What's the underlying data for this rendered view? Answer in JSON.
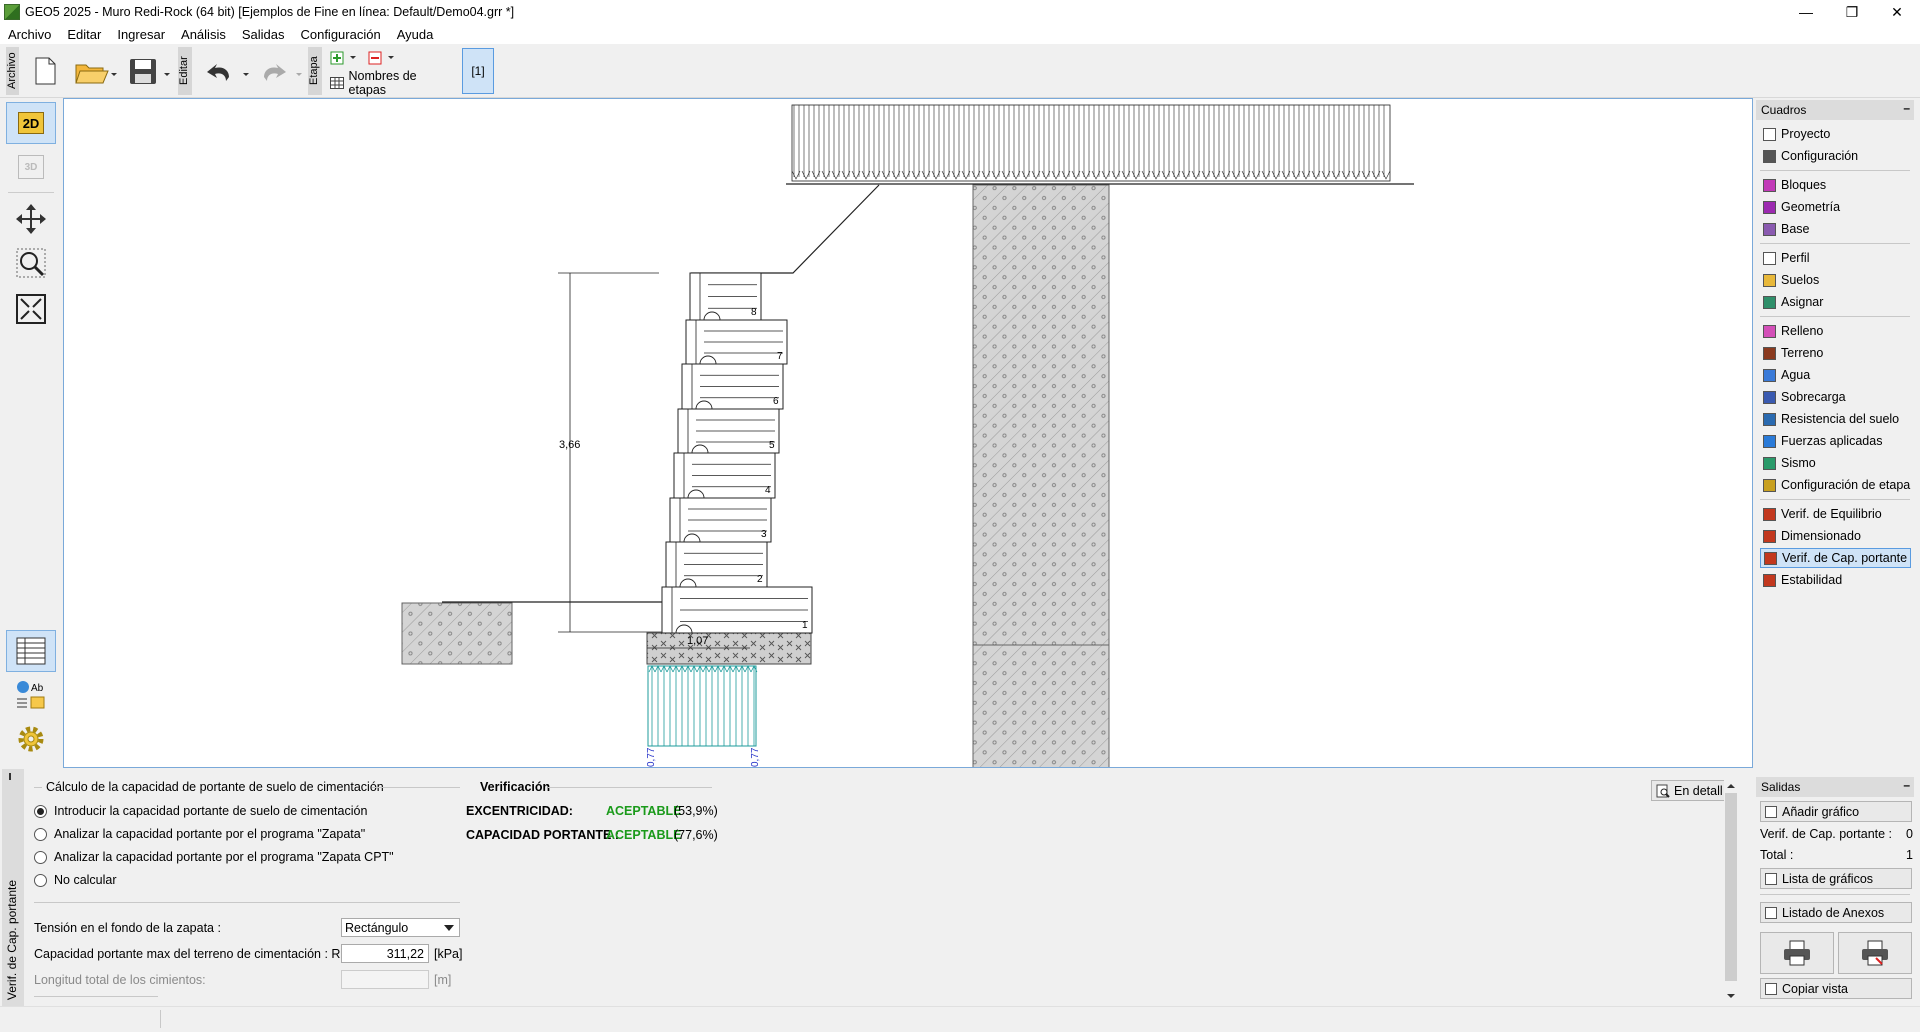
{
  "window": {
    "title": "GEO5 2025 - Muro Redi-Rock  (64 bit) [Ejemplos de Fine en línea: Default/Demo04.grr *]",
    "minimize": "—",
    "restore": "❐",
    "close": "✕"
  },
  "menu": [
    "Archivo",
    "Editar",
    "Ingresar",
    "Análisis",
    "Salidas",
    "Configuración",
    "Ayuda"
  ],
  "toolbar": {
    "archivo_label": "Archivo",
    "editar_label": "Editar",
    "etapa_label": "Etapa",
    "stage_names_label": "Nombres de etapas",
    "stage_current": "[1]"
  },
  "left_tools": {
    "view_2d": "2D",
    "view_3d": "3D"
  },
  "drawing": {
    "height_dim": "3,66",
    "base_dim": "1,07",
    "block_numbers": [
      "1",
      "2",
      "3",
      "4",
      "5",
      "6",
      "7",
      "8"
    ],
    "stress_left": "0,77",
    "stress_right": "0,77"
  },
  "right_panel": {
    "header": "Cuadros",
    "groups": [
      [
        {
          "label": "Proyecto",
          "icon": "project-icon"
        },
        {
          "label": "Configuración",
          "icon": "gear-icon"
        }
      ],
      [
        {
          "label": "Bloques",
          "icon": "blocks-icon"
        },
        {
          "label": "Geometría",
          "icon": "geometry-icon"
        },
        {
          "label": "Base",
          "icon": "base-icon"
        }
      ],
      [
        {
          "label": "Perfil",
          "icon": "profile-icon"
        },
        {
          "label": "Suelos",
          "icon": "soils-icon"
        },
        {
          "label": "Asignar",
          "icon": "assign-icon"
        }
      ],
      [
        {
          "label": "Relleno",
          "icon": "backfill-icon"
        },
        {
          "label": "Terreno",
          "icon": "terrain-icon"
        },
        {
          "label": "Agua",
          "icon": "water-icon"
        },
        {
          "label": "Sobrecarga",
          "icon": "surcharge-icon"
        },
        {
          "label": "Resistencia del suelo",
          "icon": "resistance-icon"
        },
        {
          "label": "Fuerzas aplicadas",
          "icon": "forces-icon"
        },
        {
          "label": "Sismo",
          "icon": "earthquake-icon"
        },
        {
          "label": "Configuración de etapa",
          "icon": "stage-settings-icon"
        }
      ],
      [
        {
          "label": "Verif. de Equilibrio",
          "icon": "equilibrium-icon"
        },
        {
          "label": "Dimensionado",
          "icon": "dimensioning-icon"
        },
        {
          "label": "Verif. de Cap. portante",
          "icon": "bearing-icon",
          "active": true
        },
        {
          "label": "Estabilidad",
          "icon": "stability-icon"
        }
      ]
    ]
  },
  "bottom": {
    "side_label": "Verif. de Cap. portante",
    "group_title": "Cálculo de la capacidad de portante de suelo de cimentación",
    "options": [
      {
        "label": "Introducir la capacidad portante de suelo de cimentación",
        "checked": true
      },
      {
        "label": "Analizar la capacidad portante por el programa \"Zapata\"",
        "checked": false
      },
      {
        "label": "Analizar la capacidad portante por el programa \"Zapata CPT\"",
        "checked": false
      },
      {
        "label": "No calcular",
        "checked": false
      }
    ],
    "stress_label": "Tensión en el fondo de la zapata :",
    "stress_value": "Rectángulo",
    "capacity_label": "Capacidad portante max del terreno de cimentación :  R =",
    "capacity_value": "311,22",
    "capacity_unit": "[kPa]",
    "length_label": "Longitud total de los cimientos:",
    "length_unit": "[m]",
    "verification_title": "Verificación",
    "ecc_label": "EXCENTRICIDAD:",
    "ecc_status": "ACEPTABLE",
    "ecc_value": "(53,9%)",
    "cap_label": "CAPACIDAD PORTANTE :",
    "cap_status": "ACEPTABLE",
    "cap_value": "(77,6%)",
    "detail_button": "En detall"
  },
  "salidas": {
    "header": "Salidas",
    "add_graphic": "Añadir gráfico",
    "verif_label": "Verif. de Cap. portante :",
    "verif_count": "0",
    "total_label": "Total :",
    "total_count": "1",
    "graphics_list": "Lista de gráficos",
    "annex_list": "Listado de Anexos",
    "copy_view": "Copiar vista"
  },
  "colors": {
    "accent": "#7aa9d9",
    "ok": "#1a9a1a",
    "active_bg": "#cfe3f7"
  }
}
